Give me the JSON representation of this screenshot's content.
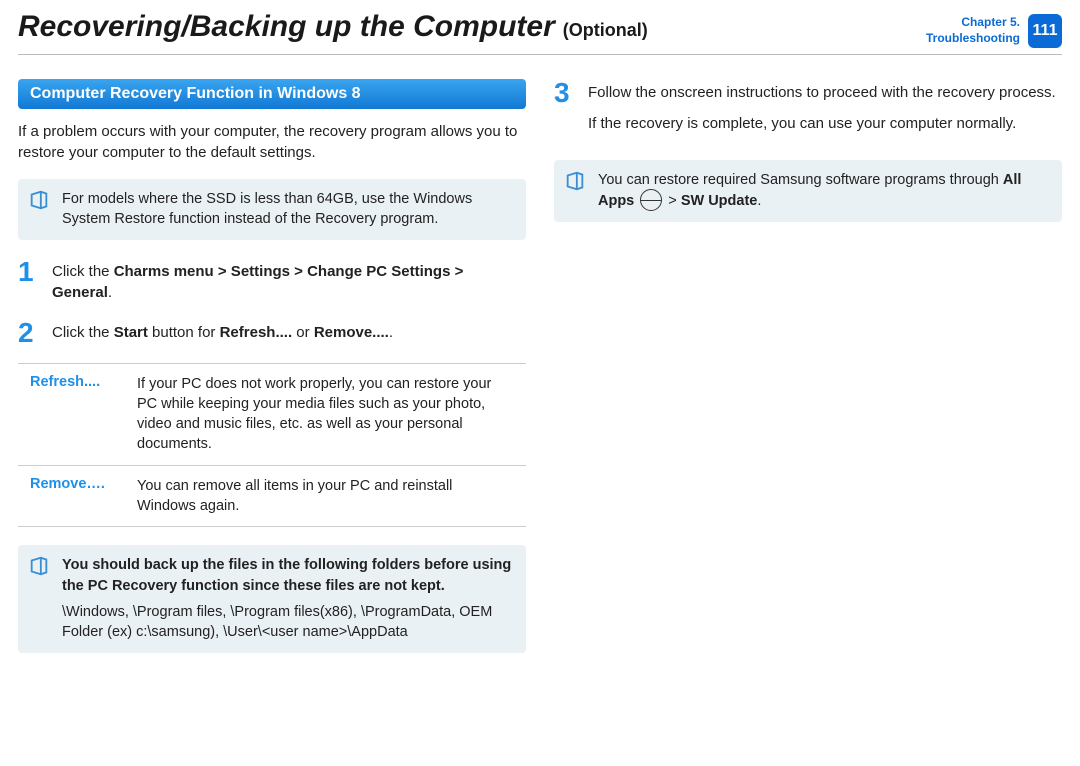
{
  "header": {
    "title": "Recovering/Backing up the Computer",
    "subtitle": "(Optional)",
    "chapter_line1": "Chapter 5.",
    "chapter_line2": "Troubleshooting",
    "page_number": "111"
  },
  "left": {
    "section_heading": "Computer Recovery Function in Windows 8",
    "intro": "If a problem occurs with your computer, the recovery program allows you to restore your computer to the default settings.",
    "note1": "For models where the SSD is less than 64GB, use the Windows System Restore function instead of the Recovery program.",
    "step1_num": "1",
    "step1_prefix": "Click the ",
    "step1_bold": "Charms menu > Settings > Change PC Settings > General",
    "step1_suffix": ".",
    "step2_num": "2",
    "step2_prefix": "Click the ",
    "step2_b1": "Start",
    "step2_mid": " button for ",
    "step2_b2": "Refresh....",
    "step2_or": " or ",
    "step2_b3": "Remove....",
    "step2_suffix": ".",
    "options": [
      {
        "label": "Refresh....",
        "desc": "If your PC does not work properly, you can restore your PC while keeping your media files such as your photo, video and music files, etc. as well as your personal documents."
      },
      {
        "label": "Remove….",
        "desc": "You can remove all items in your PC and reinstall Windows again."
      }
    ],
    "backup_note_bold": "You should back up the files in the following folders before using the PC Recovery function since these files are not kept.",
    "backup_note_body": "\\Windows, \\Program files, \\Program files(x86), \\ProgramData, OEM Folder (ex) c:\\samsung), \\User\\<user name>\\AppData"
  },
  "right": {
    "step3_num": "3",
    "step3_p1": "Follow the onscreen instructions to proceed with the recovery process.",
    "step3_p2": "If the recovery is complete, you can use your computer normally.",
    "restore_note_prefix": "You can restore required Samsung software programs through ",
    "restore_note_b1": "All Apps",
    "restore_note_gt1": " ",
    "restore_note_gt2": " > ",
    "restore_note_b2": "SW Update",
    "restore_note_suffix": "."
  }
}
